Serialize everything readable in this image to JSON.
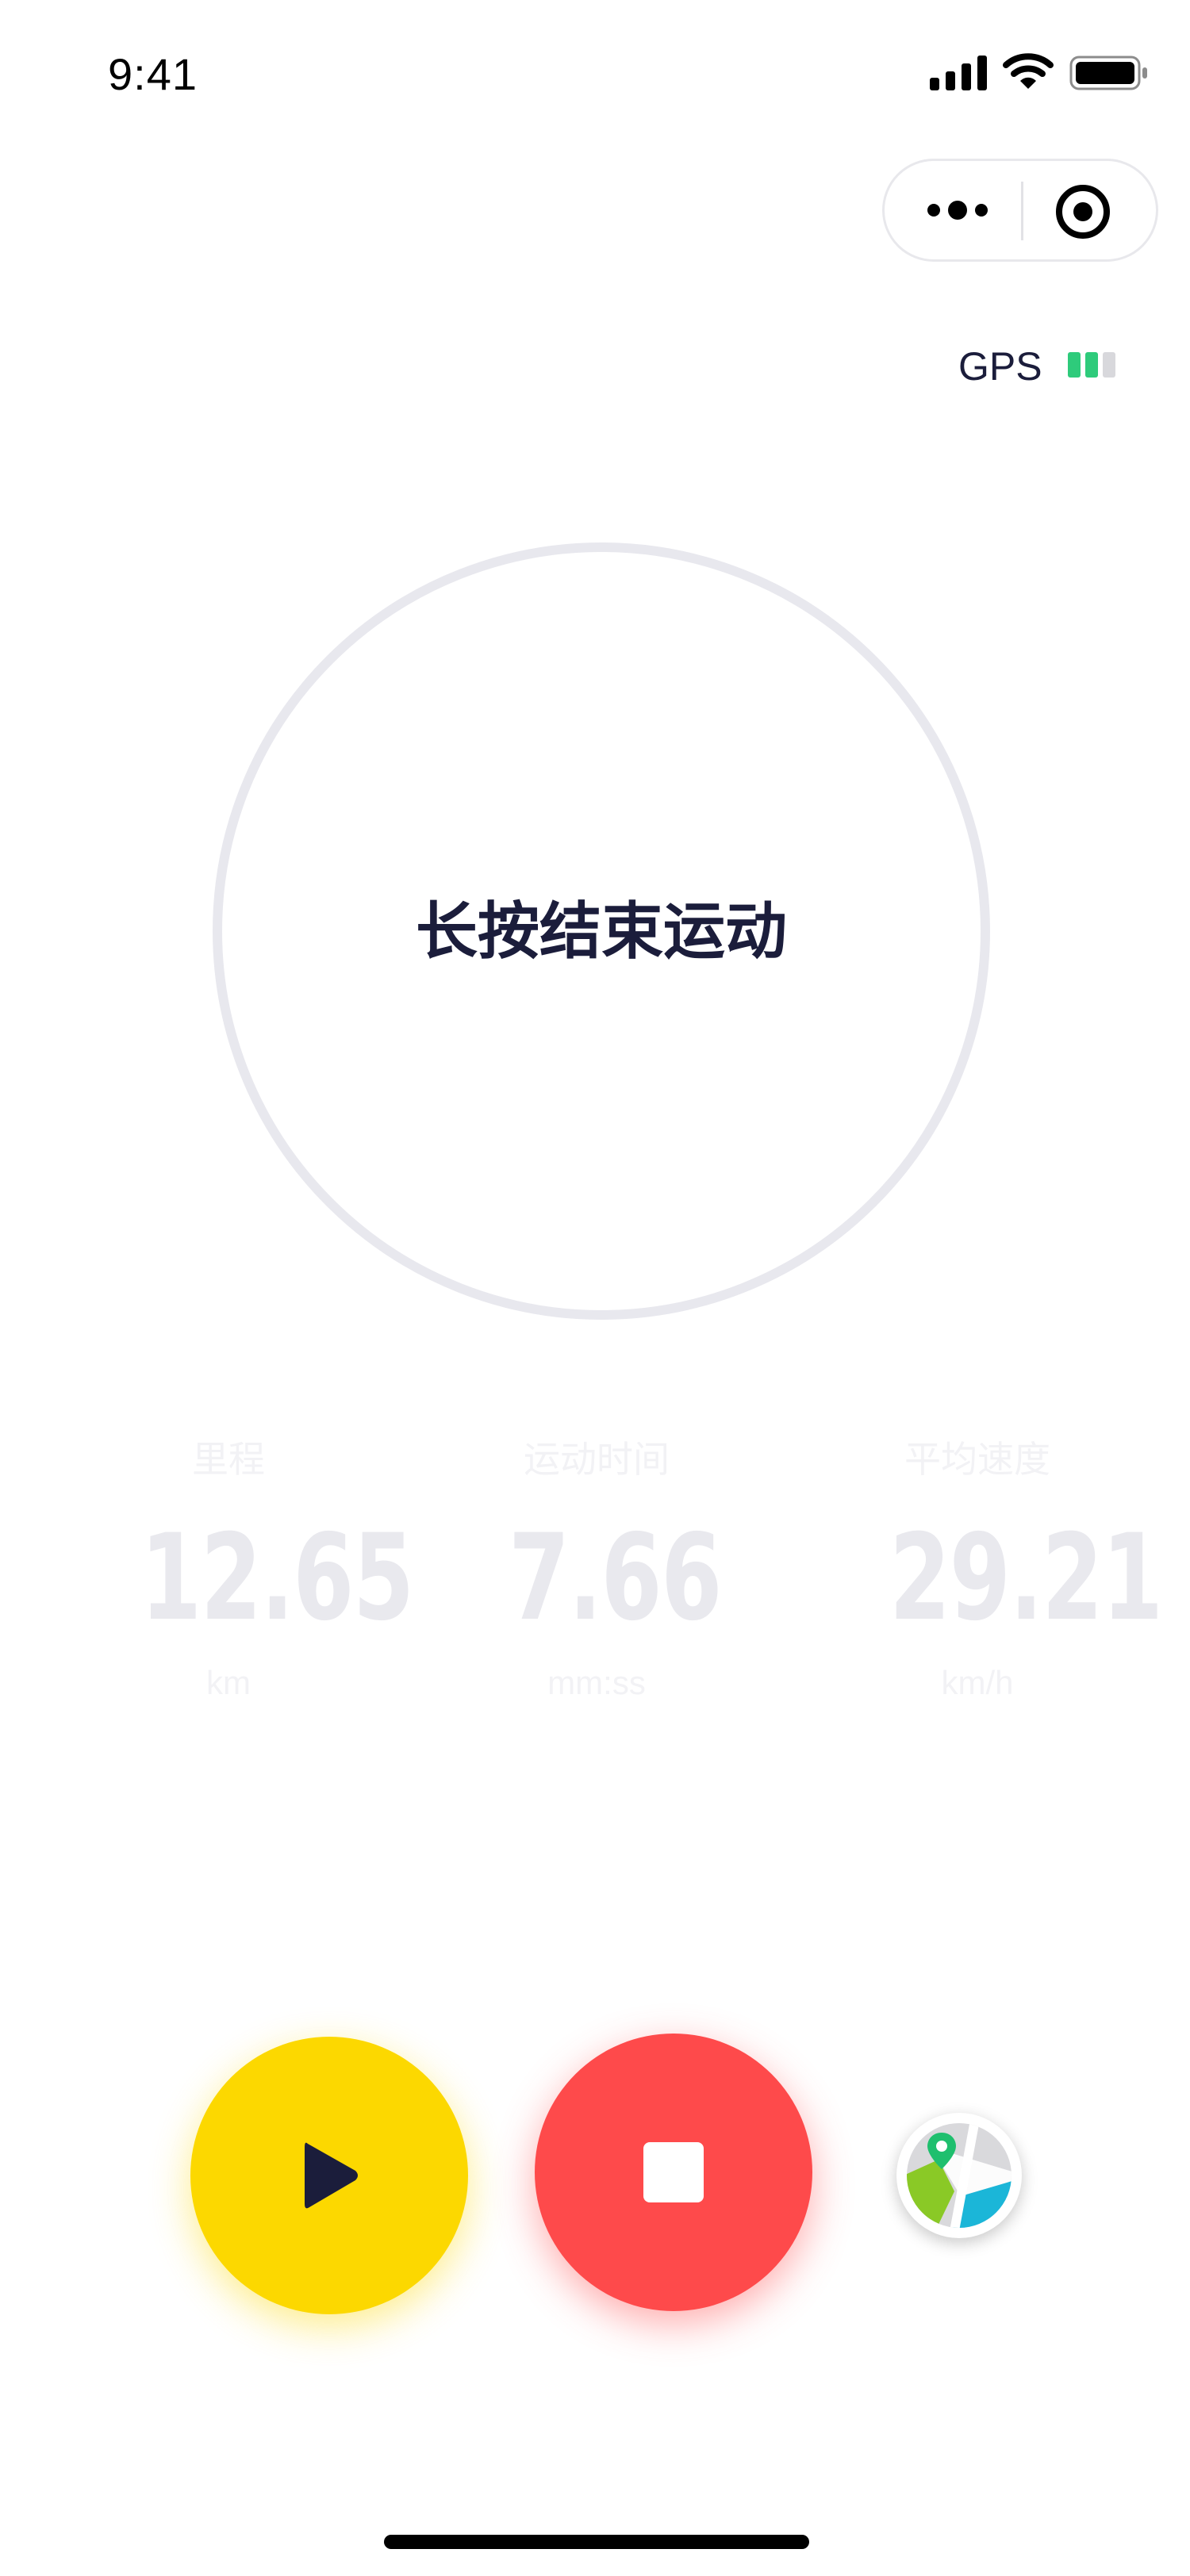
{
  "status_bar": {
    "time": "9:41",
    "icons": [
      "cellular-signal-icon",
      "wifi-icon",
      "battery-icon"
    ]
  },
  "capsule": {
    "more_icon": "more-dots-icon",
    "close_icon": "target-close-icon"
  },
  "gps": {
    "label": "GPS",
    "signal_level": 0.67,
    "colors": {
      "active": "#2ecb7b",
      "inactive": "#d8d8dc"
    }
  },
  "main": {
    "hint_text": "长按结束运动",
    "ring_color": "#e8e8ee"
  },
  "stats": [
    {
      "label": "里程",
      "value": "12.65",
      "unit": "km"
    },
    {
      "label": "运动时间",
      "value": "7.66",
      "unit": "mm:ss"
    },
    {
      "label": "平均速度",
      "value": "29.21",
      "unit": "km/h"
    }
  ],
  "controls": {
    "resume_icon": "play-icon",
    "stop_icon": "stop-icon",
    "map_icon": "map-icon",
    "colors": {
      "resume": "#fcd800",
      "stop": "#fe4a4b",
      "icon_dark": "#1b1d3b"
    }
  }
}
